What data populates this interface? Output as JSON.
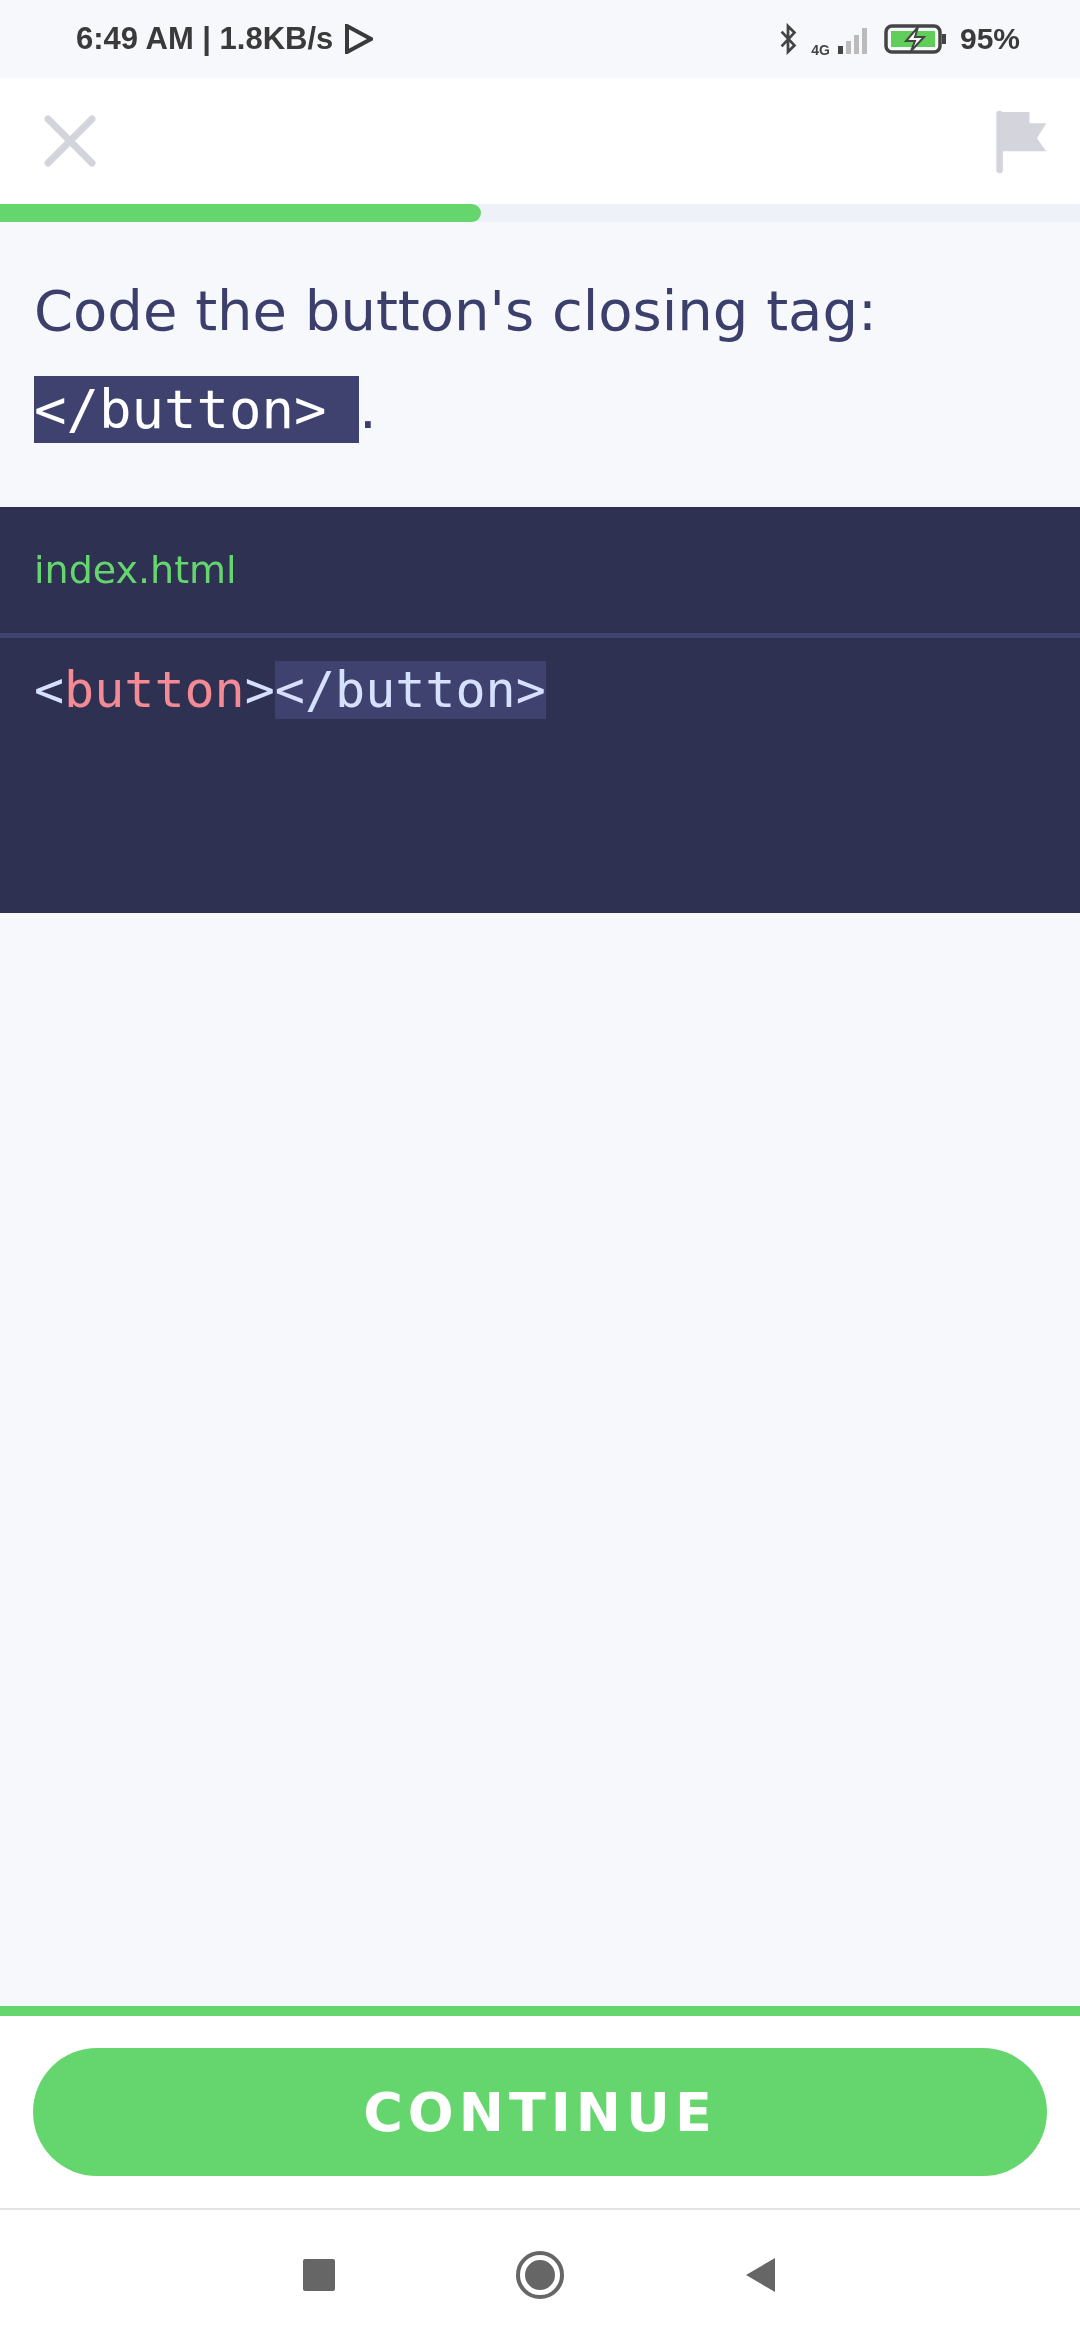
{
  "status_bar": {
    "time": "6:49 AM | 1.8KB/s",
    "network": "4G",
    "battery": "95%"
  },
  "progress": {
    "level": 0.445
  },
  "question": {
    "text": "Code the button's closing tag:",
    "code": "</button> ",
    "end": "."
  },
  "editor": {
    "file": "index.html",
    "tokens": [
      {
        "text": "<",
        "kind": "punct"
      },
      {
        "text": "button",
        "kind": "tag"
      },
      {
        "text": ">",
        "kind": "punct"
      },
      {
        "text": "</button>",
        "kind": "answer"
      }
    ]
  },
  "continue_button": "CONTINUE"
}
